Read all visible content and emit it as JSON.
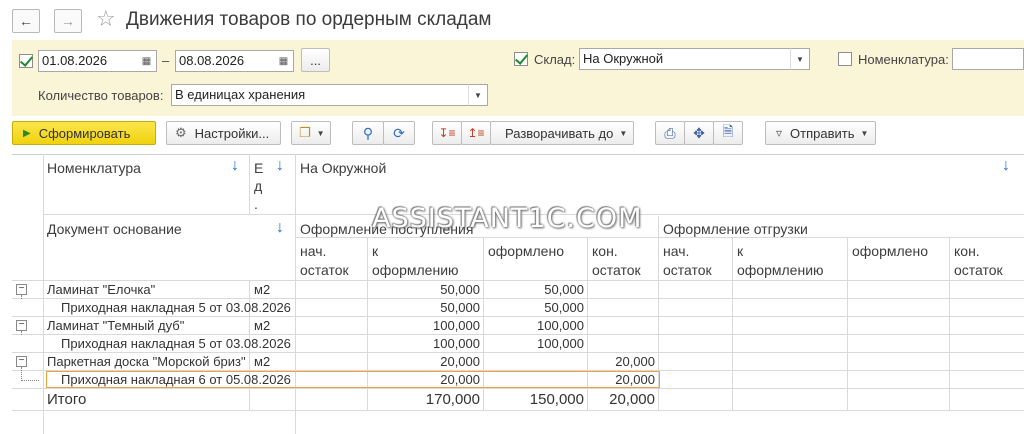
{
  "window": {
    "title": "Движения товаров по ордерным складам"
  },
  "filters": {
    "date_from": "01.08.2026",
    "date_sep": "–",
    "date_to": "08.08.2026",
    "more_btn": "...",
    "warehouse_label": "Склад:",
    "warehouse_value": "На Окружной",
    "nomenclature_label": "Номенклатура:",
    "qty_label": "Количество товаров:",
    "qty_value": "В единицах хранения"
  },
  "toolbar": {
    "generate": "Сформировать",
    "settings": "Настройки...",
    "expand_to": "Разворачивать до",
    "send": "Отправить"
  },
  "table": {
    "h_nomenclature": "Номенклатура",
    "h_unit_1": "Е",
    "h_unit_2": "д",
    "h_unit_3": ".",
    "h_warehouse": "На Окружной",
    "h_doc_basis": "Документ основание",
    "h_receipt": "Оформление поступления",
    "h_shipment": "Оформление отгрузки",
    "cols": {
      "start_1": "нач.",
      "start_2": "остаток",
      "to_do_1": "к",
      "to_do_2": "оформлению",
      "done": "оформлено",
      "end_1": "кон.",
      "end_2": "остаток"
    },
    "rows": [
      {
        "name": "Ламинат \"Елочка\"",
        "unit": "м2",
        "to_do": "50,000",
        "done": "50,000",
        "end": ""
      },
      {
        "name": "Приходная накладная 5 от 03.08.2026",
        "unit": "",
        "to_do": "50,000",
        "done": "50,000",
        "end": ""
      },
      {
        "name": "Ламинат \"Темный дуб\"",
        "unit": "м2",
        "to_do": "100,000",
        "done": "100,000",
        "end": ""
      },
      {
        "name": "Приходная накладная 5 от 03.08.2026",
        "unit": "",
        "to_do": "100,000",
        "done": "100,000",
        "end": ""
      },
      {
        "name": "Паркетная доска \"Морской бриз\"",
        "unit": "м2",
        "to_do": "20,000",
        "done": "",
        "end": "20,000"
      },
      {
        "name": "Приходная накладная 6 от 05.08.2026",
        "unit": "",
        "to_do": "20,000",
        "done": "",
        "end": "20,000"
      }
    ],
    "total": {
      "label": "Итого",
      "to_do": "170,000",
      "done": "150,000",
      "end": "20,000"
    }
  },
  "watermark": "ASSISTANT1C.COM",
  "colors": {
    "filter_bg": "#fbf5d8",
    "primary_btn": "#f0d20f",
    "highlight": "#f0a03c",
    "sort_arrow": "#1e6fd9"
  }
}
